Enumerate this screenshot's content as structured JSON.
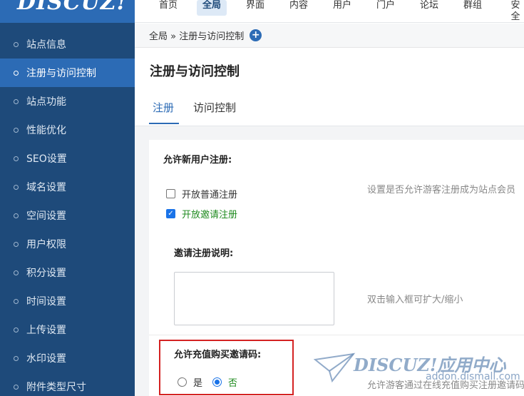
{
  "logo": {
    "text": "DISCUZ!"
  },
  "sidebar": {
    "items": [
      {
        "label": "站点信息"
      },
      {
        "label": "注册与访问控制",
        "active": true
      },
      {
        "label": "站点功能"
      },
      {
        "label": "性能优化"
      },
      {
        "label": "SEO设置"
      },
      {
        "label": "域名设置"
      },
      {
        "label": "空间设置"
      },
      {
        "label": "用户权限"
      },
      {
        "label": "积分设置"
      },
      {
        "label": "时间设置"
      },
      {
        "label": "上传设置"
      },
      {
        "label": "水印设置"
      },
      {
        "label": "附件类型尺寸"
      }
    ]
  },
  "topnav": {
    "items": [
      {
        "label": "首页"
      },
      {
        "label": "全局",
        "active": true
      },
      {
        "label": "界面"
      },
      {
        "label": "内容"
      },
      {
        "label": "用户"
      },
      {
        "label": "门户"
      },
      {
        "label": "论坛"
      },
      {
        "label": "群组"
      },
      {
        "label": "安全"
      }
    ]
  },
  "breadcrumb": {
    "text": "全局 » 注册与访问控制",
    "add_icon": "+"
  },
  "page": {
    "title": "注册与访问控制",
    "tabs": [
      {
        "label": "注册",
        "active": true
      },
      {
        "label": "访问控制"
      }
    ]
  },
  "form": {
    "allow_register": {
      "label": "允许新用户注册:",
      "options": [
        {
          "label": "开放普通注册",
          "checked": false
        },
        {
          "label": "开放邀请注册",
          "checked": true
        }
      ],
      "hint": "设置是否允许游客注册成为站点会员"
    },
    "invite_desc": {
      "label": "邀请注册说明:",
      "value": "",
      "hint": "双击输入框可扩大/缩小"
    },
    "buy_invite": {
      "label": "允许充值购买邀请码:",
      "options": [
        {
          "label": "是",
          "checked": false
        },
        {
          "label": "否",
          "checked": true
        }
      ],
      "hint": "允许游客通过在线充值购买注册邀请码"
    }
  },
  "watermark": {
    "brand": "DISCUZ!应用中心",
    "url": "addon.dismall.com"
  },
  "colors": {
    "sidebar": "#1e4a7a",
    "accent": "#2c6bb5",
    "highlight": "#d42222",
    "checked_text": "#1f8a1f"
  }
}
